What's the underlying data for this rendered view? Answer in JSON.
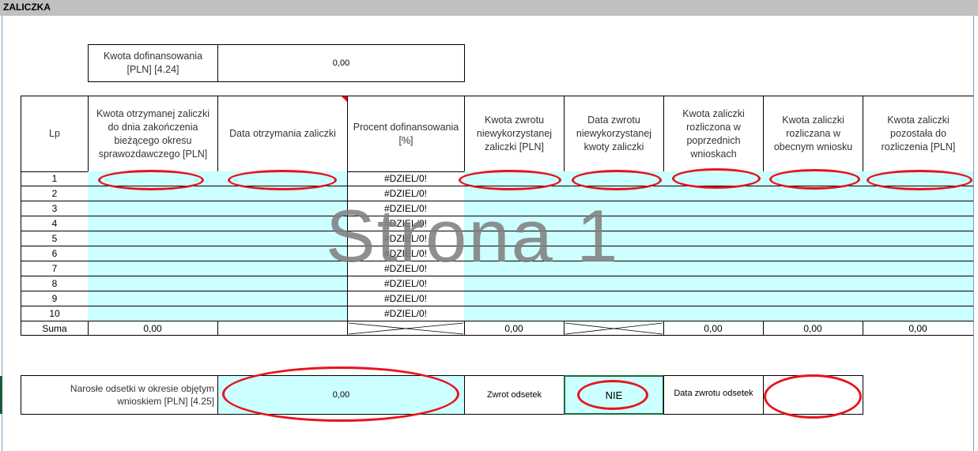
{
  "sheet": {
    "section_title": "ZALICZKA",
    "watermark": "Strona 1"
  },
  "summary_top": {
    "label": "Kwota dofinansowania [PLN] [4.24]",
    "value": "0,00"
  },
  "table": {
    "headers": [
      "Lp",
      "Kwota otrzymanej zaliczki do dnia zakończenia bieżącego okresu sprawozdawczego [PLN]",
      "Data otrzymania zaliczki",
      "Procent dofinansowania [%]",
      "Kwota zwrotu niewykorzystanej zaliczki [PLN]",
      "Data zwrotu niewykorzystanej kwoty zaliczki",
      "Kwota zaliczki rozliczona w poprzednich wnioskach",
      "Kwota zaliczki rozliczana w obecnym wniosku",
      "Kwota zaliczki pozostała do rozliczenia [PLN]"
    ],
    "rows": [
      {
        "lp": "1",
        "procent": "#DZIEL/0!"
      },
      {
        "lp": "2",
        "procent": "#DZIEL/0!"
      },
      {
        "lp": "3",
        "procent": "#DZIEL/0!"
      },
      {
        "lp": "4",
        "procent": "#DZIEL/0!"
      },
      {
        "lp": "5",
        "procent": "#DZIEL/0!"
      },
      {
        "lp": "6",
        "procent": "#DZIEL/0!"
      },
      {
        "lp": "7",
        "procent": "#DZIEL/0!"
      },
      {
        "lp": "8",
        "procent": "#DZIEL/0!"
      },
      {
        "lp": "9",
        "procent": "#DZIEL/0!"
      },
      {
        "lp": "10",
        "procent": "#DZIEL/0!"
      }
    ],
    "sum": {
      "label": "Suma",
      "kwota_otrzymanej": "0,00",
      "kwota_zwrotu": "0,00",
      "rozliczona_poprzednie": "0,00",
      "rozliczana_obecny": "0,00",
      "pozostala": "0,00"
    }
  },
  "bottom": {
    "odsetki_label": "Narosłe odsetki w okresie objętym wnioskiem [PLN] [4.25]",
    "odsetki_value": "0,00",
    "zwrot_label": "Zwrot odsetek",
    "zwrot_value": "NIE",
    "data_zwrotu_label": "Data zwrotu odsetek",
    "data_zwrotu_value": ""
  },
  "colors": {
    "input_fill": "#ccffff",
    "annotation_red": "#e8141b",
    "header_bar": "#c0c0c0"
  }
}
